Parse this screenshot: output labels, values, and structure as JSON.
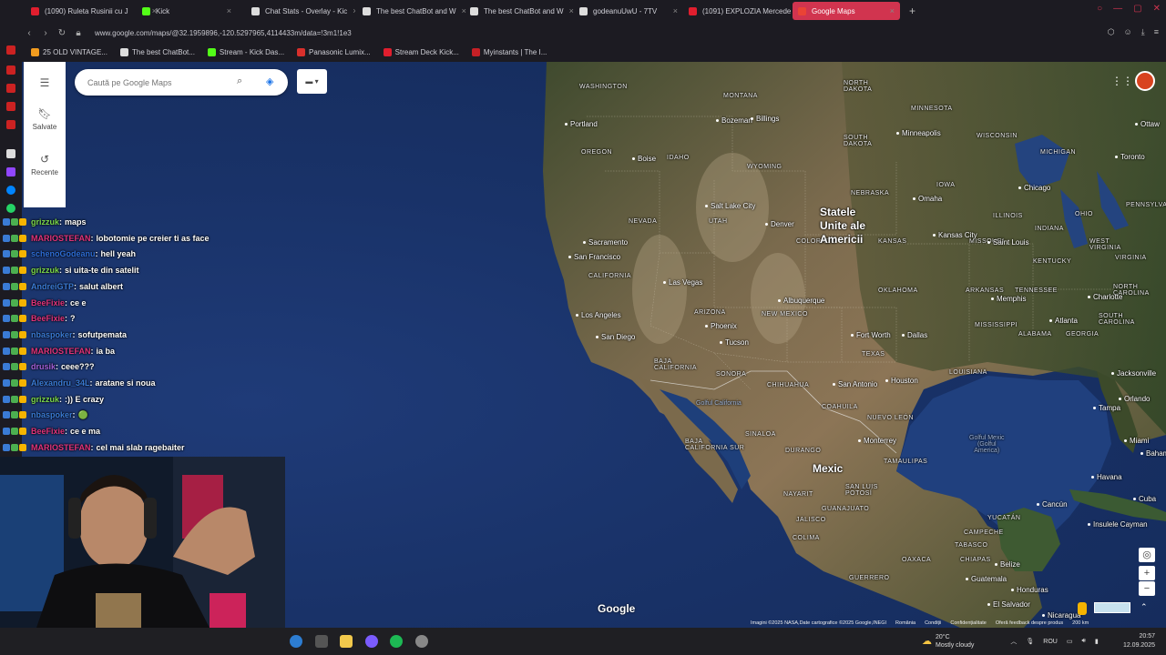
{
  "browser": {
    "tabs": [
      {
        "label": "(1090) Ruleta Rusinii cu J",
        "color": "#e01e2e",
        "active": false
      },
      {
        "label": "Kick",
        "color": "#53fc18",
        "active": false
      },
      {
        "label": "Chat Stats - Overlay - Kic",
        "color": "#dddddd",
        "active": false
      },
      {
        "label": "The best ChatBot and W",
        "color": "#dddddd",
        "active": false
      },
      {
        "label": "The best ChatBot and W",
        "color": "#dddddd",
        "active": false
      },
      {
        "label": "godeanuUwU - 7TV",
        "color": "#dddddd",
        "active": false
      },
      {
        "label": "(1091) EXPLOZIA Mercede",
        "color": "#e01e2e",
        "active": false
      },
      {
        "label": "Google Maps",
        "color": "#ea4335",
        "active": true
      }
    ],
    "new_tab": "+",
    "url": "www.google.com/maps/@32.1959896,-120.5297965,4114433m/data=!3m1!1e3",
    "bookmarks": [
      {
        "label": "25 OLD VINTAGE...",
        "color": "#f29c1f"
      },
      {
        "label": "The best ChatBot...",
        "color": "#dddddd"
      },
      {
        "label": "Stream - Kick Das...",
        "color": "#53fc18"
      },
      {
        "label": "Panasonic Lumix...",
        "color": "#d9302c"
      },
      {
        "label": "Stream Deck Kick...",
        "color": "#e01e2e"
      },
      {
        "label": "Myinstants | The I...",
        "color": "#c52026"
      }
    ]
  },
  "maps": {
    "search_placeholder": "Caută pe Google Maps",
    "menu_icon": "hamburger-icon",
    "saved_label": "Salvate",
    "recent_label": "Recente",
    "logo": "Google",
    "attribution": [
      "Imagini ©2025 NASA,Date cartografice ©2025 Google,INEGI",
      "România",
      "Condiții",
      "Confidențialitate",
      "Oferă feedback despre produs",
      "200 km"
    ],
    "zoom_in": "+",
    "zoom_out": "−",
    "labels": {
      "washington": "WASHINGTON",
      "montana": "MONTANA",
      "north_dakota": "NORTH\nDAKOTA",
      "minnesota": "MINNESOTA",
      "oregon": "OREGON",
      "idaho": "IDAHO",
      "wyoming": "WYOMING",
      "south_dakota": "SOUTH\nDAKOTA",
      "wisconsin": "WISCONSIN",
      "michigan": "MICHIGAN",
      "nebraska": "NEBRASKA",
      "iowa": "IOWA",
      "nevada": "NEVADA",
      "utah": "UTAH",
      "colorado": "COLORADO",
      "kansas": "KANSAS",
      "missouri": "MISSOURI",
      "illinois": "ILLINOIS",
      "indiana": "INDIANA",
      "ohio": "OHIO",
      "pennsylvania": "PENNSYLVA",
      "california": "CALIFORNIA",
      "arizona": "ARIZONA",
      "new_mexico": "NEW MEXICO",
      "oklahoma": "OKLAHOMA",
      "arkansas": "ARKANSAS",
      "tennessee": "TENNESSEE",
      "kentucky": "KENTUCKY",
      "west_virginia": "WEST\nVIRGINIA",
      "virginia": "VIRGINIA",
      "north_carolina": "NORTH\nCAROLINA",
      "south_carolina": "SOUTH\nCAROLINA",
      "texas": "TEXAS",
      "mississippi": "MISSISSIPPI",
      "alabama": "ALABAMA",
      "georgia": "GEORGIA",
      "louisiana": "LOUISIANA",
      "baja_california": "BAJA\nCALIFORNIA",
      "sonora": "SONORA",
      "chihuahua": "CHIHUAHUA",
      "coahuila": "COAHUILA",
      "nuevo_leon": "NUEVO LEÓN",
      "tamaulipas": "TAMAULIPAS",
      "durango": "DURANGO",
      "sinaloa": "SINALOA",
      "baja_california_sur": "BAJA\nCALIFORNIA SUR",
      "nayarit": "NAYARIT",
      "jalisco": "JALISCO",
      "san_luis_potosi": "SAN LUIS\nPOTOSÍ",
      "guanajuato": "GUANAJUATO",
      "colima": "COLIMA",
      "guerrero": "GUERRERO",
      "oaxaca": "OAXACA",
      "chiapas": "CHIAPAS",
      "tabasco": "TABASCO",
      "campeche": "CAMPECHE",
      "yucatan": "YUCATÁN",
      "gulf_california": "Golful California",
      "gulf_mexico": "Golful Mexic\n(Golful\nAmerica)",
      "usa": "Statele\nUnite ale\nAmericii",
      "mexico": "Mexic",
      "seattle_area": "",
      "portland": "Portland",
      "boise": "Boise",
      "bozeman": "Bozeman",
      "billings": "Billings",
      "minneapolis": "Minneapolis",
      "omaha": "Omaha",
      "chicago": "Chicago",
      "toronto": "Toronto",
      "ottawa": "Ottaw",
      "salt_lake": "Salt Lake City",
      "denver": "Denver",
      "kansas_city": "Kansas City",
      "saint_louis": "Saint Louis",
      "sacramento": "Sacramento",
      "san_francisco": "San Francisco",
      "las_vegas": "Las Vegas",
      "los_angeles": "Los Angeles",
      "san_diego": "San Diego",
      "phoenix": "Phoenix",
      "tucson": "Tucson",
      "albuquerque": "Albuquerque",
      "fort_worth": "Fort Worth",
      "dallas": "Dallas",
      "memphis": "Memphis",
      "charlotte": "Charlotte",
      "atlanta": "Atlanta",
      "houston": "Houston",
      "san_antonio": "San Antonio",
      "jacksonville": "Jacksonville",
      "tampa": "Tampa",
      "orlando": "Orlando",
      "miami": "Miami",
      "bahamas": "Bahamas",
      "monterrey": "Monterrey",
      "havana": "Havana",
      "cuba": "Cuba",
      "cancun": "Cancún",
      "cayman": "Insulele\nCayman",
      "belize": "Belize",
      "guatemala": "Guatemala",
      "honduras": "Honduras",
      "el_salvador": "El Salvador",
      "nicaragua": "Nicaragua"
    }
  },
  "chat": [
    {
      "user": "grizzuk",
      "color": "#7bd84a",
      "msg": "maps"
    },
    {
      "user": "MARIOSTEFAN",
      "color": "#e0337a",
      "msg": "lobotomie pe creier ti as face"
    },
    {
      "user": "schenoGodeanu",
      "color": "#2e6ed8",
      "msg": "hell yeah"
    },
    {
      "user": "grizzuk",
      "color": "#7bd84a",
      "msg": "si uita-te din satelit"
    },
    {
      "user": "AndreiGTP",
      "color": "#3a7bd5",
      "msg": "salut albert"
    },
    {
      "user": "BeeFixie",
      "color": "#e0337a",
      "msg": "ce e"
    },
    {
      "user": "BeeFixie",
      "color": "#e0337a",
      "msg": "?"
    },
    {
      "user": "nbaspoker",
      "color": "#3a7bd5",
      "msg": "sofutpemata"
    },
    {
      "user": "MARIOSTEFAN",
      "color": "#e0337a",
      "msg": "ia ba"
    },
    {
      "user": "drusik",
      "color": "#a25fd8",
      "msg": "ceee???"
    },
    {
      "user": "Alexandru_34L",
      "color": "#3a7bd5",
      "msg": "aratane si noua"
    },
    {
      "user": "grizzuk",
      "color": "#7bd84a",
      "msg": ":)) E crazy"
    },
    {
      "user": "nbaspoker",
      "color": "#3a7bd5",
      "msg": "🟢"
    },
    {
      "user": "BeeFixie",
      "color": "#e0337a",
      "msg": "ce e ma"
    },
    {
      "user": "MARIOSTEFAN",
      "color": "#e0337a",
      "msg": "cel mai slab ragebaiter"
    }
  ],
  "taskbar": {
    "weather_temp": "20°C",
    "weather_desc": "Mostly cloudy",
    "language": "ROU",
    "time": "20:57",
    "date": "12.09.2025"
  }
}
